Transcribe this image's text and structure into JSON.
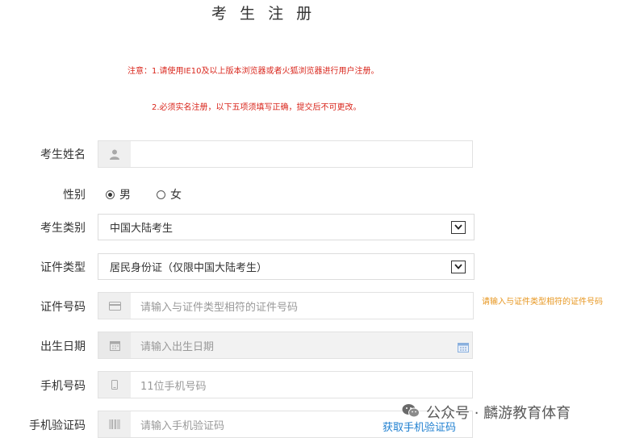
{
  "page": {
    "title": "考 生 注 册"
  },
  "notices": {
    "line1": "注意：1.请使用IE10及以上版本浏览器或者火狐浏览器进行用户注册。",
    "line2": "2.必须实名注册，以下五项须填写正确，提交后不可更改。"
  },
  "form": {
    "name": {
      "label": "考生姓名",
      "value": "",
      "placeholder": ""
    },
    "gender": {
      "label": "性别",
      "options": [
        "男",
        "女"
      ],
      "selected": "男"
    },
    "category": {
      "label": "考生类别",
      "value": "中国大陆考生"
    },
    "id_type": {
      "label": "证件类型",
      "value": "居民身份证（仅限中国大陆考生）"
    },
    "id_number": {
      "label": "证件号码",
      "placeholder": "请输入与证件类型相符的证件号码",
      "hint": "请输入与证件类型相符的证件号码"
    },
    "birth": {
      "label": "出生日期",
      "placeholder": "请输入出生日期"
    },
    "phone": {
      "label": "手机号码",
      "placeholder": "11位手机号码"
    },
    "code": {
      "label": "手机验证码",
      "placeholder": "请输入手机验证码",
      "link": "获取手机验证码"
    }
  },
  "watermark": {
    "text": "公众号 · 麟游教育体育"
  },
  "colors": {
    "notice": "#d9261c",
    "hint": "#e7961f",
    "link": "#1e7fd0"
  }
}
